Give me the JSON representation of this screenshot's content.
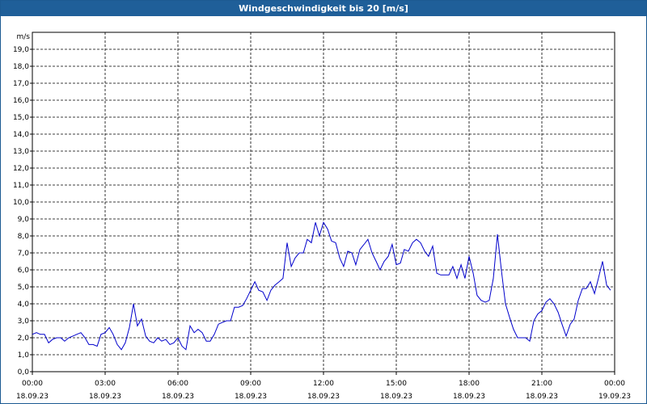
{
  "window": {
    "title": "Windgeschwindigkeit bis 20 [m/s]"
  },
  "chart_data": {
    "type": "line",
    "title": "Windgeschwindigkeit bis 20 [m/s]",
    "ylabel": "m/s",
    "xlabel": "",
    "ylim": [
      0,
      20
    ],
    "xlim_hours": [
      0,
      24
    ],
    "grid": true,
    "line_color": "#0000cc",
    "y_ticks": [
      "0,0",
      "1,0",
      "2,0",
      "3,0",
      "4,0",
      "5,0",
      "6,0",
      "7,0",
      "8,0",
      "9,0",
      "10,0",
      "11,0",
      "12,0",
      "13,0",
      "14,0",
      "15,0",
      "16,0",
      "17,0",
      "18,0",
      "19,0"
    ],
    "x_ticks": [
      {
        "time": "00:00",
        "date": "18.09.23"
      },
      {
        "time": "03:00",
        "date": "18.09.23"
      },
      {
        "time": "06:00",
        "date": "18.09.23"
      },
      {
        "time": "09:00",
        "date": "18.09.23"
      },
      {
        "time": "12:00",
        "date": "18.09.23"
      },
      {
        "time": "15:00",
        "date": "18.09.23"
      },
      {
        "time": "18:00",
        "date": "18.09.23"
      },
      {
        "time": "21:00",
        "date": "18.09.23"
      },
      {
        "time": "00:00",
        "date": "19.09.23"
      }
    ],
    "series": [
      {
        "x": [
          0.0,
          0.17,
          0.33,
          0.5,
          0.67,
          0.83,
          1.0,
          1.17,
          1.33,
          1.5,
          1.67,
          1.83,
          2.0,
          2.17,
          2.33,
          2.5,
          2.67,
          2.83,
          3.0,
          3.17,
          3.33,
          3.5,
          3.67,
          3.83,
          4.0,
          4.17,
          4.33,
          4.5,
          4.67,
          4.83,
          5.0,
          5.17,
          5.33,
          5.5,
          5.67,
          5.83,
          6.0,
          6.17,
          6.33,
          6.5,
          6.67,
          6.83,
          7.0,
          7.17,
          7.33,
          7.5,
          7.67,
          7.83,
          8.0,
          8.17,
          8.33,
          8.5,
          8.67,
          8.83,
          9.0,
          9.17,
          9.33,
          9.5,
          9.67,
          9.83,
          10.0,
          10.17,
          10.33,
          10.5,
          10.67,
          10.83,
          11.0,
          11.17,
          11.33,
          11.5,
          11.67,
          11.83,
          12.0,
          12.17,
          12.33,
          12.5,
          12.67,
          12.83,
          13.0,
          13.17,
          13.33,
          13.5,
          13.67,
          13.83,
          14.0,
          14.17,
          14.33,
          14.5,
          14.67,
          14.83,
          15.0,
          15.17,
          15.33,
          15.5,
          15.67,
          15.83,
          16.0,
          16.17,
          16.33,
          16.5,
          16.67,
          16.83,
          17.0,
          17.17,
          17.33,
          17.5,
          17.67,
          17.83,
          18.0,
          18.17,
          18.33,
          18.5,
          18.67,
          18.83,
          19.0,
          19.17,
          19.33,
          19.5,
          19.67,
          19.83,
          20.0,
          20.17,
          20.33,
          20.5,
          20.67,
          20.83,
          21.0,
          21.17,
          21.33,
          21.5,
          21.67,
          21.83,
          22.0,
          22.17,
          22.33,
          22.5,
          22.67,
          22.83,
          23.0,
          23.17,
          23.33,
          23.5,
          23.67,
          23.83
        ],
        "values": [
          2.2,
          2.3,
          2.2,
          2.2,
          1.7,
          1.9,
          2.0,
          2.0,
          1.8,
          2.0,
          2.1,
          2.2,
          2.3,
          2.0,
          1.6,
          1.6,
          1.5,
          2.2,
          2.3,
          2.6,
          2.2,
          1.6,
          1.3,
          1.7,
          2.6,
          4.0,
          2.7,
          3.1,
          2.1,
          1.8,
          1.7,
          2.0,
          1.8,
          1.9,
          1.6,
          1.7,
          2.0,
          1.5,
          1.3,
          2.7,
          2.3,
          2.5,
          2.3,
          1.8,
          1.8,
          2.2,
          2.8,
          2.9,
          3.0,
          3.0,
          3.8,
          3.8,
          3.9,
          4.3,
          4.8,
          5.3,
          4.8,
          4.7,
          4.2,
          4.8,
          5.1,
          5.3,
          5.5,
          7.6,
          6.2,
          6.7,
          7.0,
          7.0,
          7.8,
          7.6,
          8.8,
          8.0,
          8.8,
          8.4,
          7.7,
          7.6,
          6.7,
          6.2,
          7.1,
          7.0,
          6.3,
          7.2,
          7.5,
          7.8,
          7.0,
          6.5,
          6.0,
          6.5,
          6.8,
          7.5,
          6.3,
          6.4,
          7.2,
          7.1,
          7.6,
          7.8,
          7.6,
          7.1,
          6.8,
          7.4,
          5.8,
          5.7,
          5.7,
          5.7,
          6.2,
          5.5,
          6.3,
          5.5,
          6.8,
          5.8,
          4.5,
          4.2,
          4.1,
          4.2,
          5.5,
          8.1,
          6.0,
          4.0,
          3.2,
          2.5,
          2.0,
          2.0,
          2.0,
          1.8,
          3.0,
          3.4,
          3.6,
          4.1,
          4.3,
          4.0,
          3.5,
          2.8,
          2.1,
          2.8,
          3.1,
          4.2,
          4.9,
          4.9,
          5.3,
          4.6,
          5.5,
          6.5,
          5.1,
          4.8
        ]
      }
    ]
  }
}
